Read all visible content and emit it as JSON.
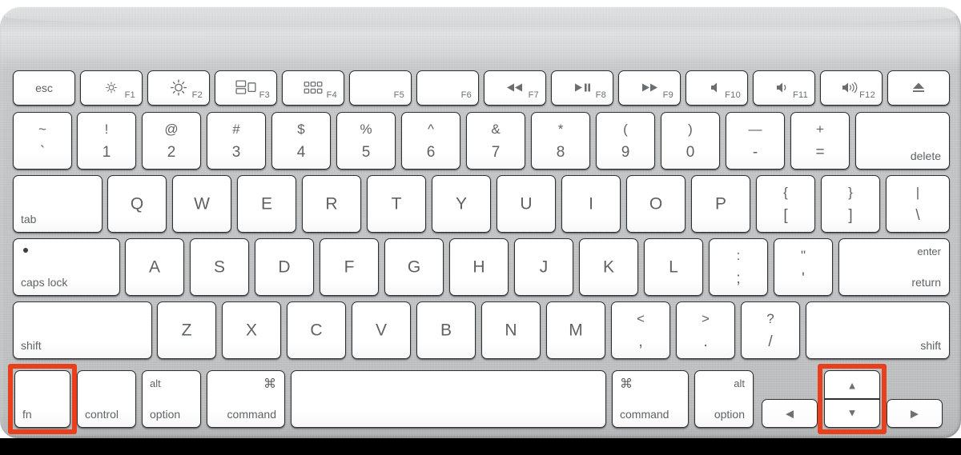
{
  "device": {
    "name": "Apple Wireless Keyboard",
    "body_color": "#c6c8ca",
    "key_color": "#ffffff",
    "legend_color": "#5f6265",
    "highlight_color": "#e8401c"
  },
  "highlights": [
    {
      "name": "fn-key-highlight",
      "target": "fn"
    },
    {
      "name": "up-down-arrow-highlight",
      "target": "arrow-up-down"
    }
  ],
  "rows": {
    "function_row": {
      "esc": {
        "label": "esc"
      },
      "f1": {
        "fnum": "F1",
        "icon": "brightness-down-icon"
      },
      "f2": {
        "fnum": "F2",
        "icon": "brightness-up-icon"
      },
      "f3": {
        "fnum": "F3",
        "icon": "mission-control-icon"
      },
      "f4": {
        "fnum": "F4",
        "icon": "launchpad-icon"
      },
      "f5": {
        "fnum": "F5",
        "icon": "none"
      },
      "f6": {
        "fnum": "F6",
        "icon": "none"
      },
      "f7": {
        "fnum": "F7",
        "icon": "rewind-icon"
      },
      "f8": {
        "fnum": "F8",
        "icon": "play-pause-icon"
      },
      "f9": {
        "fnum": "F9",
        "icon": "fast-forward-icon"
      },
      "f10": {
        "fnum": "F10",
        "icon": "mute-icon"
      },
      "f11": {
        "fnum": "F11",
        "icon": "volume-down-icon"
      },
      "f12": {
        "fnum": "F12",
        "icon": "volume-up-icon"
      },
      "eject": {
        "icon": "eject-icon"
      }
    },
    "number_row": [
      {
        "name": "backtick",
        "top": "~",
        "bottom": "`"
      },
      {
        "name": "1",
        "top": "!",
        "bottom": "1"
      },
      {
        "name": "2",
        "top": "@",
        "bottom": "2"
      },
      {
        "name": "3",
        "top": "#",
        "bottom": "3"
      },
      {
        "name": "4",
        "top": "$",
        "bottom": "4"
      },
      {
        "name": "5",
        "top": "%",
        "bottom": "5"
      },
      {
        "name": "6",
        "top": "^",
        "bottom": "6"
      },
      {
        "name": "7",
        "top": "&",
        "bottom": "7"
      },
      {
        "name": "8",
        "top": "*",
        "bottom": "8"
      },
      {
        "name": "9",
        "top": "(",
        "bottom": "9"
      },
      {
        "name": "0",
        "top": ")",
        "bottom": "0"
      },
      {
        "name": "minus",
        "top": "—",
        "bottom": "-"
      },
      {
        "name": "equals",
        "top": "+",
        "bottom": "="
      }
    ],
    "number_row_delete": {
      "label": "delete"
    },
    "qwerty_row": {
      "tab": "tab",
      "letters": [
        "Q",
        "W",
        "E",
        "R",
        "T",
        "Y",
        "U",
        "I",
        "O",
        "P"
      ],
      "bracket_left": {
        "top": "{",
        "bottom": "["
      },
      "bracket_right": {
        "top": "}",
        "bottom": "]"
      },
      "backslash": {
        "top": "|",
        "bottom": "\\"
      }
    },
    "home_row": {
      "caps_lock": "caps lock",
      "letters": [
        "A",
        "S",
        "D",
        "F",
        "G",
        "H",
        "J",
        "K",
        "L"
      ],
      "semicolon": {
        "top": ":",
        "bottom": ";"
      },
      "quote": {
        "top": "\"",
        "bottom": "'"
      },
      "return": {
        "top": "enter",
        "bottom": "return"
      }
    },
    "shift_row": {
      "shift_left": "shift",
      "letters": [
        "Z",
        "X",
        "C",
        "V",
        "B",
        "N",
        "M"
      ],
      "comma": {
        "top": "<",
        "bottom": ","
      },
      "period": {
        "top": ">",
        "bottom": "."
      },
      "slash": {
        "top": "?",
        "bottom": "/"
      },
      "shift_right": "shift"
    },
    "bottom_row": {
      "fn": "fn",
      "control": "control",
      "option_left": {
        "top": "alt",
        "bottom": "option"
      },
      "command_left": {
        "top": "⌘",
        "bottom": "command"
      },
      "space": "",
      "command_right": {
        "top": "⌘",
        "bottom": "command"
      },
      "option_right": {
        "top": "alt",
        "bottom": "option"
      },
      "arrow_left": "◀",
      "arrow_up": "▲",
      "arrow_down": "▼",
      "arrow_right": "▶"
    }
  }
}
